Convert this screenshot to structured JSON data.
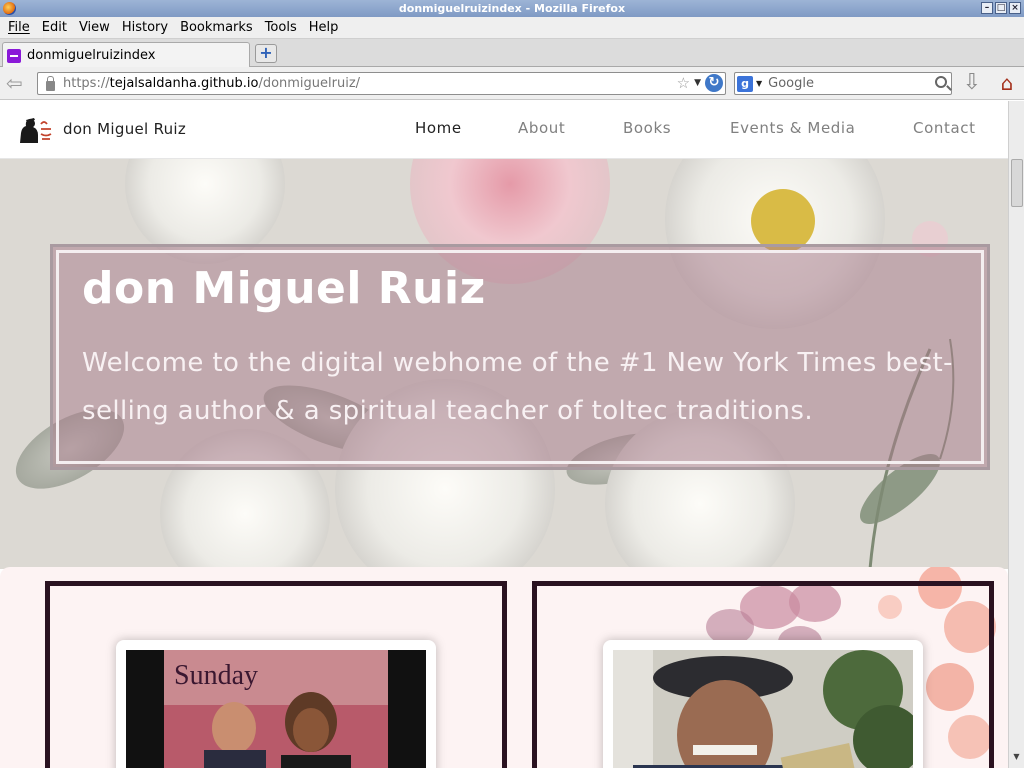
{
  "window": {
    "title": "donmiguelruizindex - Mozilla Firefox"
  },
  "menubar": {
    "items": [
      "File",
      "Edit",
      "View",
      "History",
      "Bookmarks",
      "Tools",
      "Help"
    ]
  },
  "tabs": [
    {
      "label": "donmiguelruizindex"
    }
  ],
  "navbar": {
    "url_prefix": "https://",
    "url_domain": "tejalsaldanha.github.io",
    "url_path": "/donmiguelruiz/",
    "search_placeholder": "Google",
    "search_engine_glyph": "g"
  },
  "site": {
    "name": "don Miguel Ruiz",
    "nav": [
      {
        "label": "Home",
        "active": true
      },
      {
        "label": "About",
        "active": false
      },
      {
        "label": "Books",
        "active": false
      },
      {
        "label": "Events & Media",
        "active": false
      },
      {
        "label": "Contact",
        "active": false
      }
    ]
  },
  "hero": {
    "title": "don Miguel Ruiz",
    "subtitle": "Welcome to the digital webhome of the #1 New York Times best-selling author & a spiritual teacher of toltec traditions."
  },
  "content": {
    "left_photo_caption": "Sunday",
    "colors": {
      "card_border": "#2a1220",
      "content_bg": "#fdf3f3",
      "hero_overlay": "#a87c8c"
    }
  }
}
